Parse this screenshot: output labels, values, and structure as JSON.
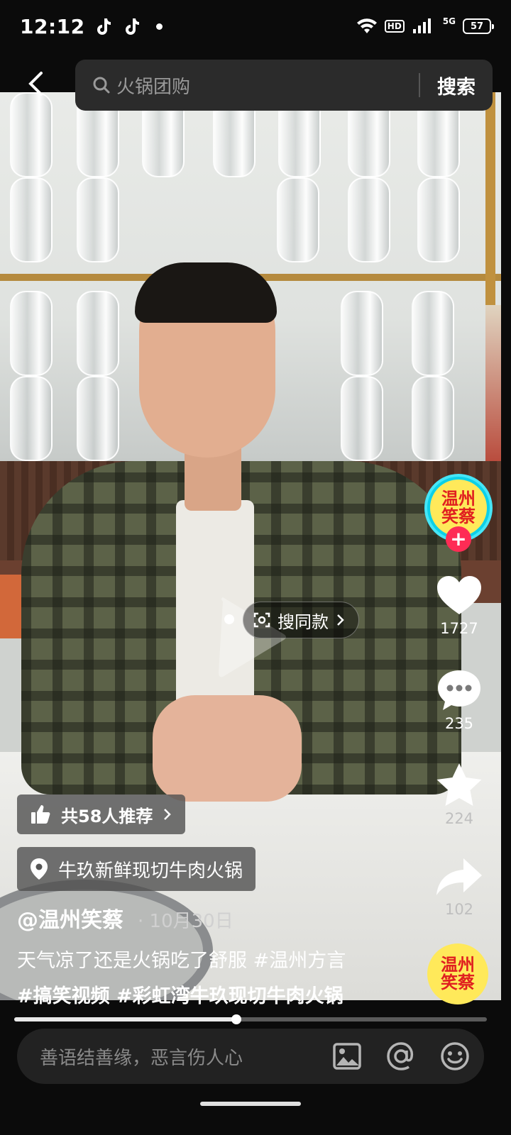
{
  "status_bar": {
    "time": "12:12",
    "hd_label": "HD",
    "signal_label": "5G",
    "battery": "57"
  },
  "search": {
    "query": "火锅团购",
    "button_label": "搜索"
  },
  "video": {
    "same_style_label": "搜同款",
    "recommend_label": "共58人推荐",
    "location_label": "牛玖新鲜现切牛肉火锅",
    "author": "@温州笑蔡",
    "date": "· 10月30日",
    "caption_line1": "天气凉了还是火锅吃了舒服 #温州方言",
    "caption_line2": "#搞笑视频 #彩虹湾牛玖现切牛肉火锅",
    "progress": 0.47
  },
  "avatar_text": [
    "温州",
    "笑蔡"
  ],
  "music_text": [
    "温州",
    "笑蔡"
  ],
  "rail": {
    "likes": "1727",
    "comments": "235",
    "favorites": "224",
    "shares": "102"
  },
  "comment_bar": {
    "placeholder": "善语结善缘，恶言伤人心"
  },
  "icons": [
    "back-icon",
    "search-icon",
    "play-icon",
    "heart-icon",
    "comment-icon",
    "star-icon",
    "share-icon",
    "thumbs-up-icon",
    "location-pin-icon",
    "image-icon",
    "at-icon",
    "emoji-icon",
    "tiktok-icon",
    "wifi-icon"
  ],
  "colors": {
    "accent": "#fe2c55",
    "avatar_ring": "#46e6f7",
    "avatar_bg": "#ffe95a"
  }
}
